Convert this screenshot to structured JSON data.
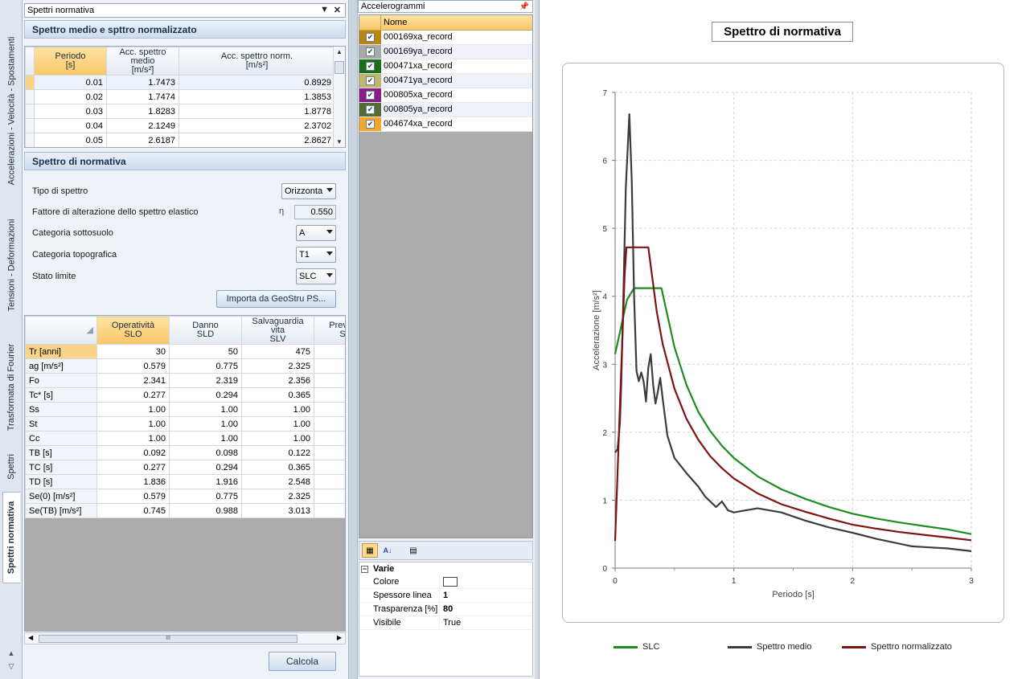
{
  "side_tabs": [
    "Accelerazioni - Velocità - Spostamenti",
    "Tensioni - Deformazioni",
    "Trasformata di Fourier",
    "Spettri",
    "Spettri normativa"
  ],
  "left_panel": {
    "title": "Spettri normativa",
    "section1": "Spettro medio e spttro normalizzato",
    "table1": {
      "headers": [
        "Periodo\n[s]",
        "Acc. spettro medio\n[m/s²]",
        "Acc. spettro norm.\n[m/s²]"
      ],
      "rows": [
        [
          "0.01",
          "1.7473",
          "0.8929"
        ],
        [
          "0.02",
          "1.7474",
          "1.3853"
        ],
        [
          "0.03",
          "1.8283",
          "1.8778"
        ],
        [
          "0.04",
          "2.1249",
          "2.3702"
        ],
        [
          "0.05",
          "2.6187",
          "2.8627"
        ]
      ]
    },
    "section2": "Spettro di normativa",
    "form": {
      "tipo_label": "Tipo di spettro",
      "tipo_value": "Orizzonta",
      "fattore_label": "Fattore di alterazione dello spettro elastico",
      "eta_symbol": "η",
      "fattore_value": "0.550",
      "suolo_label": "Categoria sottosuolo",
      "suolo_value": "A",
      "topo_label": "Categoria topografica",
      "topo_value": "T1",
      "stato_label": "Stato limite",
      "stato_value": "SLC",
      "importa_button": "Importa da GeoStru PS..."
    },
    "table2": {
      "headers": [
        "Operatività\nSLO",
        "Danno\nSLD",
        "Salvaguardia vita\nSLV",
        "Prev. c\nS"
      ],
      "rows": [
        [
          "Tr [anni]",
          "30",
          "50",
          "475"
        ],
        [
          "ag [m/s²]",
          "0.579",
          "0.775",
          "2.325"
        ],
        [
          "Fo",
          "2.341",
          "2.319",
          "2.356"
        ],
        [
          "Tc* [s]",
          "0.277",
          "0.294",
          "0.365"
        ],
        [
          "Ss",
          "1.00",
          "1.00",
          "1.00"
        ],
        [
          "St",
          "1.00",
          "1.00",
          "1.00"
        ],
        [
          "Cc",
          "1.00",
          "1.00",
          "1.00"
        ],
        [
          "TB [s]",
          "0.092",
          "0.098",
          "0.122"
        ],
        [
          "TC [s]",
          "0.277",
          "0.294",
          "0.365"
        ],
        [
          "TD [s]",
          "1.836",
          "1.916",
          "2.548"
        ],
        [
          "Se(0) [m/s²]",
          "0.579",
          "0.775",
          "2.325"
        ],
        [
          "Se(TB) [m/s²]",
          "0.745",
          "0.988",
          "3.013"
        ]
      ]
    },
    "scroll_grip": "III",
    "calcola_button": "Calcola"
  },
  "accelerogrammi": {
    "title": "Accelerogrammi",
    "column": "Nome",
    "items": [
      {
        "name": "000169xa_record",
        "color": "#b8860b"
      },
      {
        "name": "000169ya_record",
        "color": "#a9a9a9"
      },
      {
        "name": "000471xa_record",
        "color": "#1a6e1a"
      },
      {
        "name": "000471ya_record",
        "color": "#bdb76b"
      },
      {
        "name": "000805xa_record",
        "color": "#8b1a8b"
      },
      {
        "name": "000805ya_record",
        "color": "#556b2f"
      },
      {
        "name": "004674xa_record",
        "color": "#f4a52a"
      }
    ]
  },
  "properties": {
    "category": "Varie",
    "rows": [
      {
        "key": "Colore",
        "value": ""
      },
      {
        "key": "Spessore linea",
        "value": "1"
      },
      {
        "key": "Trasparenza [%]",
        "value": "80"
      },
      {
        "key": "Visibile",
        "value": "True"
      }
    ]
  },
  "chart_data": {
    "type": "line",
    "title": "Spettro di normativa",
    "xlabel": "Periodo [s]",
    "ylabel": "Accelerazione [m/s²]",
    "xlim": [
      0,
      3
    ],
    "ylim": [
      0,
      7
    ],
    "xticks": [
      0,
      1,
      2,
      3
    ],
    "yticks": [
      0,
      1,
      2,
      3,
      4,
      5,
      6,
      7
    ],
    "grid": true,
    "legend": "bottom",
    "series": [
      {
        "name": "SLC",
        "color": "#1e8c1e",
        "points": [
          [
            0,
            3.15
          ],
          [
            0.05,
            3.55
          ],
          [
            0.1,
            3.95
          ],
          [
            0.16,
            4.12
          ],
          [
            0.39,
            4.12
          ],
          [
            0.5,
            3.25
          ],
          [
            0.6,
            2.7
          ],
          [
            0.7,
            2.3
          ],
          [
            0.8,
            2.02
          ],
          [
            0.9,
            1.8
          ],
          [
            1.0,
            1.62
          ],
          [
            1.2,
            1.35
          ],
          [
            1.4,
            1.16
          ],
          [
            1.6,
            1.02
          ],
          [
            1.8,
            0.9
          ],
          [
            2.0,
            0.8
          ],
          [
            2.2,
            0.73
          ],
          [
            2.4,
            0.67
          ],
          [
            2.6,
            0.62
          ],
          [
            2.8,
            0.57
          ],
          [
            3.0,
            0.5
          ]
        ]
      },
      {
        "name": "Spettro medio",
        "color": "#3c3c3c",
        "points": [
          [
            0,
            1.7
          ],
          [
            0.02,
            1.75
          ],
          [
            0.04,
            2.12
          ],
          [
            0.05,
            2.62
          ],
          [
            0.07,
            4.0
          ],
          [
            0.09,
            5.6
          ],
          [
            0.12,
            6.68
          ],
          [
            0.14,
            5.7
          ],
          [
            0.16,
            4.0
          ],
          [
            0.18,
            2.9
          ],
          [
            0.2,
            2.75
          ],
          [
            0.22,
            2.88
          ],
          [
            0.24,
            2.75
          ],
          [
            0.26,
            2.45
          ],
          [
            0.28,
            2.95
          ],
          [
            0.3,
            3.15
          ],
          [
            0.32,
            2.7
          ],
          [
            0.34,
            2.42
          ],
          [
            0.36,
            2.6
          ],
          [
            0.38,
            2.8
          ],
          [
            0.4,
            2.5
          ],
          [
            0.44,
            1.95
          ],
          [
            0.5,
            1.62
          ],
          [
            0.6,
            1.4
          ],
          [
            0.7,
            1.2
          ],
          [
            0.76,
            1.05
          ],
          [
            0.82,
            0.95
          ],
          [
            0.85,
            0.9
          ],
          [
            0.9,
            0.98
          ],
          [
            0.95,
            0.85
          ],
          [
            1.0,
            0.82
          ],
          [
            1.1,
            0.85
          ],
          [
            1.2,
            0.88
          ],
          [
            1.4,
            0.82
          ],
          [
            1.6,
            0.7
          ],
          [
            1.8,
            0.6
          ],
          [
            2.0,
            0.52
          ],
          [
            2.2,
            0.43
          ],
          [
            2.5,
            0.32
          ],
          [
            2.8,
            0.29
          ],
          [
            3.0,
            0.25
          ]
        ]
      },
      {
        "name": "Spettro normalizzato",
        "color": "#7d1414",
        "points": [
          [
            0,
            0.4
          ],
          [
            0.02,
            1.39
          ],
          [
            0.04,
            2.37
          ],
          [
            0.06,
            3.34
          ],
          [
            0.08,
            4.3
          ],
          [
            0.095,
            4.72
          ],
          [
            0.28,
            4.72
          ],
          [
            0.35,
            3.78
          ],
          [
            0.4,
            3.3
          ],
          [
            0.5,
            2.64
          ],
          [
            0.6,
            2.2
          ],
          [
            0.7,
            1.89
          ],
          [
            0.8,
            1.65
          ],
          [
            0.9,
            1.47
          ],
          [
            1.0,
            1.32
          ],
          [
            1.2,
            1.1
          ],
          [
            1.4,
            0.94
          ],
          [
            1.6,
            0.83
          ],
          [
            1.8,
            0.73
          ],
          [
            2.0,
            0.64
          ],
          [
            2.2,
            0.58
          ],
          [
            2.4,
            0.53
          ],
          [
            2.6,
            0.49
          ],
          [
            2.8,
            0.45
          ],
          [
            3.0,
            0.41
          ]
        ]
      }
    ]
  }
}
